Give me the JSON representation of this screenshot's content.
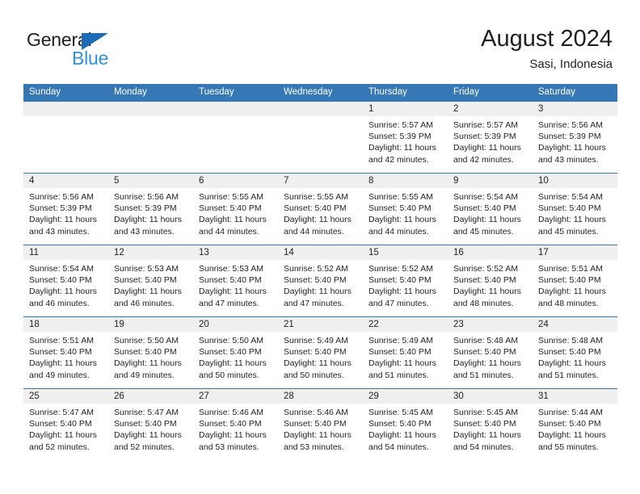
{
  "brand": {
    "name_part1": "General",
    "name_part2": "Blue",
    "triangle_icon": "triangle-icon"
  },
  "header": {
    "title": "August 2024",
    "subtitle": "Sasi, Indonesia"
  },
  "colors": {
    "header_blue": "#3578b5",
    "brand_dark_blue": "#1c6cb5",
    "brand_light_blue": "#2e93d9",
    "day_bar_gray": "#efefef",
    "text": "#231f20"
  },
  "weekdays": [
    "Sunday",
    "Monday",
    "Tuesday",
    "Wednesday",
    "Thursday",
    "Friday",
    "Saturday"
  ],
  "weeks": [
    [
      {
        "day": "",
        "sunrise": "",
        "sunset": "",
        "daylight_line1": "",
        "daylight_line2": "",
        "empty": true
      },
      {
        "day": "",
        "sunrise": "",
        "sunset": "",
        "daylight_line1": "",
        "daylight_line2": "",
        "empty": true
      },
      {
        "day": "",
        "sunrise": "",
        "sunset": "",
        "daylight_line1": "",
        "daylight_line2": "",
        "empty": true
      },
      {
        "day": "",
        "sunrise": "",
        "sunset": "",
        "daylight_line1": "",
        "daylight_line2": "",
        "empty": true
      },
      {
        "day": "1",
        "sunrise": "Sunrise: 5:57 AM",
        "sunset": "Sunset: 5:39 PM",
        "daylight_line1": "Daylight: 11 hours",
        "daylight_line2": "and 42 minutes."
      },
      {
        "day": "2",
        "sunrise": "Sunrise: 5:57 AM",
        "sunset": "Sunset: 5:39 PM",
        "daylight_line1": "Daylight: 11 hours",
        "daylight_line2": "and 42 minutes."
      },
      {
        "day": "3",
        "sunrise": "Sunrise: 5:56 AM",
        "sunset": "Sunset: 5:39 PM",
        "daylight_line1": "Daylight: 11 hours",
        "daylight_line2": "and 43 minutes."
      }
    ],
    [
      {
        "day": "4",
        "sunrise": "Sunrise: 5:56 AM",
        "sunset": "Sunset: 5:39 PM",
        "daylight_line1": "Daylight: 11 hours",
        "daylight_line2": "and 43 minutes."
      },
      {
        "day": "5",
        "sunrise": "Sunrise: 5:56 AM",
        "sunset": "Sunset: 5:39 PM",
        "daylight_line1": "Daylight: 11 hours",
        "daylight_line2": "and 43 minutes."
      },
      {
        "day": "6",
        "sunrise": "Sunrise: 5:55 AM",
        "sunset": "Sunset: 5:40 PM",
        "daylight_line1": "Daylight: 11 hours",
        "daylight_line2": "and 44 minutes."
      },
      {
        "day": "7",
        "sunrise": "Sunrise: 5:55 AM",
        "sunset": "Sunset: 5:40 PM",
        "daylight_line1": "Daylight: 11 hours",
        "daylight_line2": "and 44 minutes."
      },
      {
        "day": "8",
        "sunrise": "Sunrise: 5:55 AM",
        "sunset": "Sunset: 5:40 PM",
        "daylight_line1": "Daylight: 11 hours",
        "daylight_line2": "and 44 minutes."
      },
      {
        "day": "9",
        "sunrise": "Sunrise: 5:54 AM",
        "sunset": "Sunset: 5:40 PM",
        "daylight_line1": "Daylight: 11 hours",
        "daylight_line2": "and 45 minutes."
      },
      {
        "day": "10",
        "sunrise": "Sunrise: 5:54 AM",
        "sunset": "Sunset: 5:40 PM",
        "daylight_line1": "Daylight: 11 hours",
        "daylight_line2": "and 45 minutes."
      }
    ],
    [
      {
        "day": "11",
        "sunrise": "Sunrise: 5:54 AM",
        "sunset": "Sunset: 5:40 PM",
        "daylight_line1": "Daylight: 11 hours",
        "daylight_line2": "and 46 minutes."
      },
      {
        "day": "12",
        "sunrise": "Sunrise: 5:53 AM",
        "sunset": "Sunset: 5:40 PM",
        "daylight_line1": "Daylight: 11 hours",
        "daylight_line2": "and 46 minutes."
      },
      {
        "day": "13",
        "sunrise": "Sunrise: 5:53 AM",
        "sunset": "Sunset: 5:40 PM",
        "daylight_line1": "Daylight: 11 hours",
        "daylight_line2": "and 47 minutes."
      },
      {
        "day": "14",
        "sunrise": "Sunrise: 5:52 AM",
        "sunset": "Sunset: 5:40 PM",
        "daylight_line1": "Daylight: 11 hours",
        "daylight_line2": "and 47 minutes."
      },
      {
        "day": "15",
        "sunrise": "Sunrise: 5:52 AM",
        "sunset": "Sunset: 5:40 PM",
        "daylight_line1": "Daylight: 11 hours",
        "daylight_line2": "and 47 minutes."
      },
      {
        "day": "16",
        "sunrise": "Sunrise: 5:52 AM",
        "sunset": "Sunset: 5:40 PM",
        "daylight_line1": "Daylight: 11 hours",
        "daylight_line2": "and 48 minutes."
      },
      {
        "day": "17",
        "sunrise": "Sunrise: 5:51 AM",
        "sunset": "Sunset: 5:40 PM",
        "daylight_line1": "Daylight: 11 hours",
        "daylight_line2": "and 48 minutes."
      }
    ],
    [
      {
        "day": "18",
        "sunrise": "Sunrise: 5:51 AM",
        "sunset": "Sunset: 5:40 PM",
        "daylight_line1": "Daylight: 11 hours",
        "daylight_line2": "and 49 minutes."
      },
      {
        "day": "19",
        "sunrise": "Sunrise: 5:50 AM",
        "sunset": "Sunset: 5:40 PM",
        "daylight_line1": "Daylight: 11 hours",
        "daylight_line2": "and 49 minutes."
      },
      {
        "day": "20",
        "sunrise": "Sunrise: 5:50 AM",
        "sunset": "Sunset: 5:40 PM",
        "daylight_line1": "Daylight: 11 hours",
        "daylight_line2": "and 50 minutes."
      },
      {
        "day": "21",
        "sunrise": "Sunrise: 5:49 AM",
        "sunset": "Sunset: 5:40 PM",
        "daylight_line1": "Daylight: 11 hours",
        "daylight_line2": "and 50 minutes."
      },
      {
        "day": "22",
        "sunrise": "Sunrise: 5:49 AM",
        "sunset": "Sunset: 5:40 PM",
        "daylight_line1": "Daylight: 11 hours",
        "daylight_line2": "and 51 minutes."
      },
      {
        "day": "23",
        "sunrise": "Sunrise: 5:48 AM",
        "sunset": "Sunset: 5:40 PM",
        "daylight_line1": "Daylight: 11 hours",
        "daylight_line2": "and 51 minutes."
      },
      {
        "day": "24",
        "sunrise": "Sunrise: 5:48 AM",
        "sunset": "Sunset: 5:40 PM",
        "daylight_line1": "Daylight: 11 hours",
        "daylight_line2": "and 51 minutes."
      }
    ],
    [
      {
        "day": "25",
        "sunrise": "Sunrise: 5:47 AM",
        "sunset": "Sunset: 5:40 PM",
        "daylight_line1": "Daylight: 11 hours",
        "daylight_line2": "and 52 minutes."
      },
      {
        "day": "26",
        "sunrise": "Sunrise: 5:47 AM",
        "sunset": "Sunset: 5:40 PM",
        "daylight_line1": "Daylight: 11 hours",
        "daylight_line2": "and 52 minutes."
      },
      {
        "day": "27",
        "sunrise": "Sunrise: 5:46 AM",
        "sunset": "Sunset: 5:40 PM",
        "daylight_line1": "Daylight: 11 hours",
        "daylight_line2": "and 53 minutes."
      },
      {
        "day": "28",
        "sunrise": "Sunrise: 5:46 AM",
        "sunset": "Sunset: 5:40 PM",
        "daylight_line1": "Daylight: 11 hours",
        "daylight_line2": "and 53 minutes."
      },
      {
        "day": "29",
        "sunrise": "Sunrise: 5:45 AM",
        "sunset": "Sunset: 5:40 PM",
        "daylight_line1": "Daylight: 11 hours",
        "daylight_line2": "and 54 minutes."
      },
      {
        "day": "30",
        "sunrise": "Sunrise: 5:45 AM",
        "sunset": "Sunset: 5:40 PM",
        "daylight_line1": "Daylight: 11 hours",
        "daylight_line2": "and 54 minutes."
      },
      {
        "day": "31",
        "sunrise": "Sunrise: 5:44 AM",
        "sunset": "Sunset: 5:40 PM",
        "daylight_line1": "Daylight: 11 hours",
        "daylight_line2": "and 55 minutes."
      }
    ]
  ]
}
